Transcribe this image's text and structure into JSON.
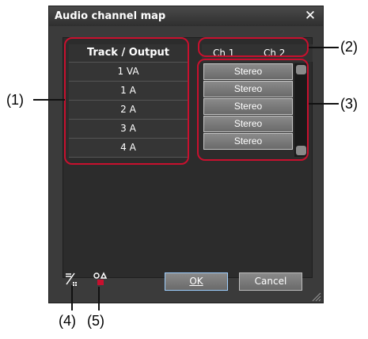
{
  "dialog": {
    "title": "Audio channel map",
    "close_glyph": "✕"
  },
  "track_table": {
    "header": "Track / Output",
    "rows": [
      "1 VA",
      "1 A",
      "2 A",
      "3 A",
      "4 A"
    ]
  },
  "channel_header": {
    "ch1": "Ch 1",
    "ch2": "Ch 2"
  },
  "channel_cells": [
    "Stereo",
    "Stereo",
    "Stereo",
    "Stereo",
    "Stereo"
  ],
  "buttons": {
    "ok": "OK",
    "cancel": "Cancel"
  },
  "icons": {
    "left": "stereo-mono-toggle-icon",
    "right": "routing-preset-icon"
  },
  "callouts": [
    "(1)",
    "(2)",
    "(3)",
    "(4)",
    "(5)"
  ],
  "colors": {
    "callout": "#c8102e",
    "dialog_bg": "#3b3b3b",
    "ok_focus": "#9fd0ff"
  }
}
